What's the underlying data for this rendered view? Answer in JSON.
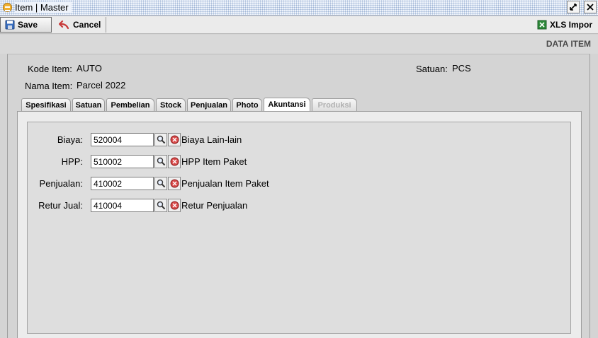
{
  "window": {
    "title": "Item | Master"
  },
  "toolbar": {
    "save_label": "Save",
    "cancel_label": "Cancel",
    "xls_label": "XLS Impor"
  },
  "header": {
    "section_title": "DATA ITEM"
  },
  "item": {
    "kode_label": "Kode Item:",
    "kode_value": "AUTO",
    "nama_label": "Nama Item:",
    "nama_value": "Parcel 2022",
    "satuan_label": "Satuan:",
    "satuan_value": "PCS"
  },
  "tabs": [
    {
      "label": "Spesifikasi",
      "state": "normal"
    },
    {
      "label": "Satuan",
      "state": "normal"
    },
    {
      "label": "Pembelian",
      "state": "normal"
    },
    {
      "label": "Stock",
      "state": "normal"
    },
    {
      "label": "Penjualan",
      "state": "normal"
    },
    {
      "label": "Photo",
      "state": "normal"
    },
    {
      "label": "Akuntansi",
      "state": "active"
    },
    {
      "label": "Produksi",
      "state": "disabled"
    }
  ],
  "akuntansi": {
    "rows": [
      {
        "label": "Biaya:",
        "code": "520004",
        "description": "Biaya Lain-lain"
      },
      {
        "label": "HPP:",
        "code": "510002",
        "description": "HPP Item Paket"
      },
      {
        "label": "Penjualan:",
        "code": "410002",
        "description": "Penjualan Item Paket"
      },
      {
        "label": "Retur Jual:",
        "code": "410004",
        "description": "Retur Penjualan"
      }
    ]
  },
  "icons": {
    "app": "app-icon",
    "restore": "restore-icon",
    "close": "close-icon",
    "save": "floppy-disk-icon",
    "cancel": "undo-arrow-icon",
    "xls": "excel-icon",
    "lookup": "magnifier-icon",
    "clear": "red-x-circle-icon"
  }
}
